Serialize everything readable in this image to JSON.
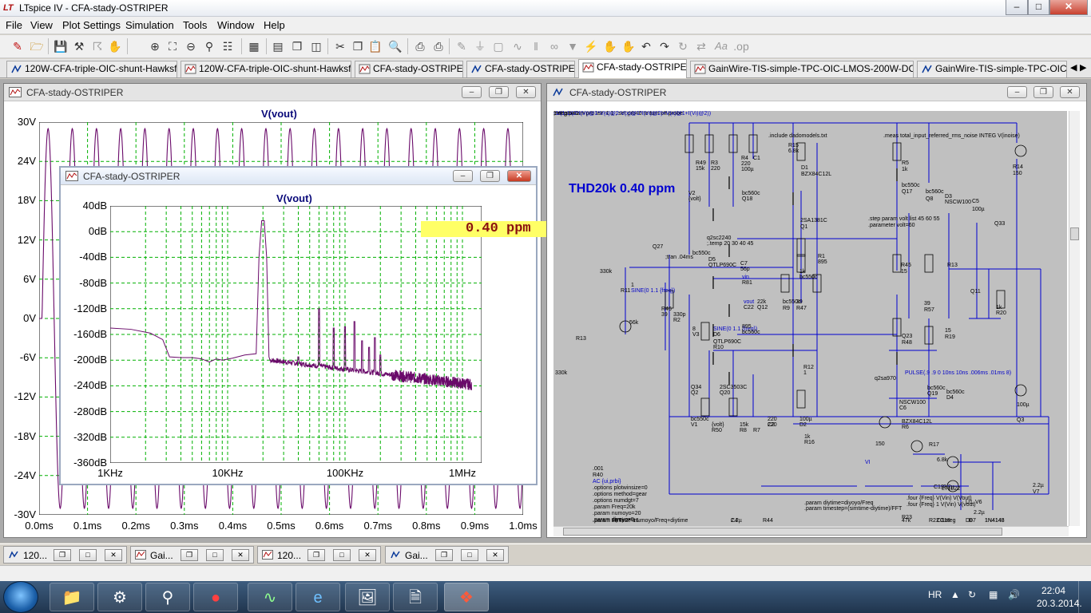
{
  "app": {
    "title": "LTspice IV - CFA-stady-OSTRIPER"
  },
  "menu": [
    "File",
    "View",
    "Plot Settings",
    "Simulation",
    "Tools",
    "Window",
    "Help"
  ],
  "tabs": [
    "120W-CFA-triple-OIC-shunt-Hawksfor-2",
    "120W-CFA-triple-OIC-shunt-Hawksfor-2",
    "CFA-stady-OSTRIPER",
    "CFA-stady-OSTRIPER",
    "CFA-stady-OSTRIPER",
    "GainWire-TIS-simple-TPC-OIC-LMOS-200W-DCservo",
    "GainWire-TIS-simple-TPC-OIC-LM"
  ],
  "active_tab_index": 4,
  "time_plot": {
    "window_title": "CFA-stady-OSTRIPER",
    "trace_name": "V(vout)",
    "y_ticks": [
      "30V",
      "24V",
      "18V",
      "12V",
      "6V",
      "0V",
      "-6V",
      "-12V",
      "-18V",
      "-24V",
      "-30V"
    ],
    "x_ticks": [
      "0.0ms",
      "0.1ms",
      "0.2ms",
      "0.3ms",
      "0.4ms",
      "0.5ms",
      "0.6ms",
      "0.7ms",
      "0.8ms",
      "0.9ms",
      "1.0ms"
    ]
  },
  "fft_plot": {
    "window_title": "CFA-stady-OSTRIPER",
    "trace_name": "V(vout)",
    "y_ticks": [
      "40dB",
      "0dB",
      "-40dB",
      "-80dB",
      "-120dB",
      "-160dB",
      "-200dB",
      "-240dB",
      "-280dB",
      "-320dB",
      "-360dB"
    ],
    "x_ticks": [
      "1KHz",
      "10KHz",
      "100KHz",
      "1MHz"
    ],
    "annotation": "0.40  ppm",
    "trace_color": "#6a0a6a"
  },
  "schematic": {
    "window_title": "CFA-stady-OSTRIPER",
    "thd_label": "THD20k 0.40 ppm",
    "labels": [
      ".include dadomodels.txt",
      ".meas total_input_referred_rms_noise INTEG V(inoise)",
      "R15",
      "6.8k",
      "R49",
      "15k",
      "R3",
      "220",
      "R4",
      "220",
      "C1",
      "100µ",
      "D1",
      "BZX84C12L",
      "R5",
      "1k",
      "R14",
      "150",
      "V2",
      "{volt}",
      "bc560c",
      "Q18",
      "bc550c",
      "Q17",
      "bc560c",
      "Q8",
      "D3",
      "NSCW100",
      "C5",
      "100µ",
      ".step param volt list 45 60 55",
      ".parameter volt=60",
      "2SA1381C",
      "Q1",
      "Q33",
      "q2sc2240",
      ";.temp 20 30 40 45",
      "Q27",
      "bc550c",
      ";tran .04ms",
      "D5",
      "QTLP690C",
      "R1",
      "895",
      "C7",
      "56p",
      "R45",
      "15",
      "R13",
      "330k",
      "R11",
      "1",
      "SINE(0 1.1 {freq})",
      "vin",
      "R81",
      "1k",
      "bc550c",
      "Q11",
      "R46",
      "39",
      "vout",
      "C22",
      "330p",
      "R2",
      "22k",
      "Q12",
      "bc550c",
      "R9",
      "39",
      "R47",
      "39",
      "R57",
      "1k",
      "R20",
      "56k",
      "R13",
      "8",
      "V3",
      "SINE(0 1.1 {freq})",
      "D6",
      "QTLP690C",
      "R10",
      "895",
      "bc560c",
      "Q23",
      "R48",
      "15",
      "R19",
      "330k",
      "R12",
      "1",
      "PULSE(.9 .9 0 10ns 10ns .006ms .01ms 8)",
      "q2sa970",
      "Q34",
      "Q2",
      "2SC3503C",
      "Q20",
      "bc560c",
      "Q19",
      "bc560c",
      "D4",
      "NSCW100",
      "C6",
      "100µ",
      "Q3",
      "bc550c",
      "V1",
      "{volt}",
      "R50",
      "15k",
      "R8",
      "220",
      "R7",
      "220",
      "C2",
      "100µ",
      "D2",
      "BZX84C12L",
      "R6",
      "1k",
      "R16",
      "150",
      "R17",
      "6.8k",
      "VI",
      ".001",
      "R40",
      "AC {ui,prbi}",
      ".options plotwinsize=0",
      ".options method=gear",
      ".options numdgt=7",
      ".param Freq=20k",
      ".param numoyo=20",
      ".param diyoyo=5",
      ".param FFT=2**16",
      ".param simtime=numoyo/Freq+diytime",
      ".param diytime=diyoyo/Freq",
      ".param timestep=(simtime-diytime)/FFT",
      ".four {Freq} V(Vin) V(Vout)",
      ".four {Freq} 1 V(Vin) V(vout)",
      "R23",
      "47k",
      "C19",
      "2.2µ",
      "LT1022",
      "U1",
      "V6",
      "C3",
      "2.2µ",
      "D7",
      "D8",
      "1N4148",
      "1N4148",
      "R22",
      "1meg",
      "C18",
      "2.2µ",
      "V7",
      "C4",
      "2.2µ",
      "R44",
      "1meg",
      ";.step param prb list -1 1 ; set prb=0 to turn off probe",
      ".set prb=0",
      "-1/(1-1/(2*I(Vi)@1*V(x)@2-V(x)@1*I(Vi)@2)+V(x)@1+I(Vi)@2))"
    ]
  },
  "mdi_taskbar": [
    "120...",
    "Gai...",
    "120...",
    "Gai..."
  ],
  "system_tray": {
    "language": "HR",
    "time": "22:04",
    "date": "20.3.2014."
  },
  "colors": {
    "grid": "#00b000",
    "fft_trace": "#6a0a6a",
    "time_trace": "#6a0a6a",
    "annotation_bg": "#ffff66",
    "schematic_wire": "#0000d0"
  }
}
